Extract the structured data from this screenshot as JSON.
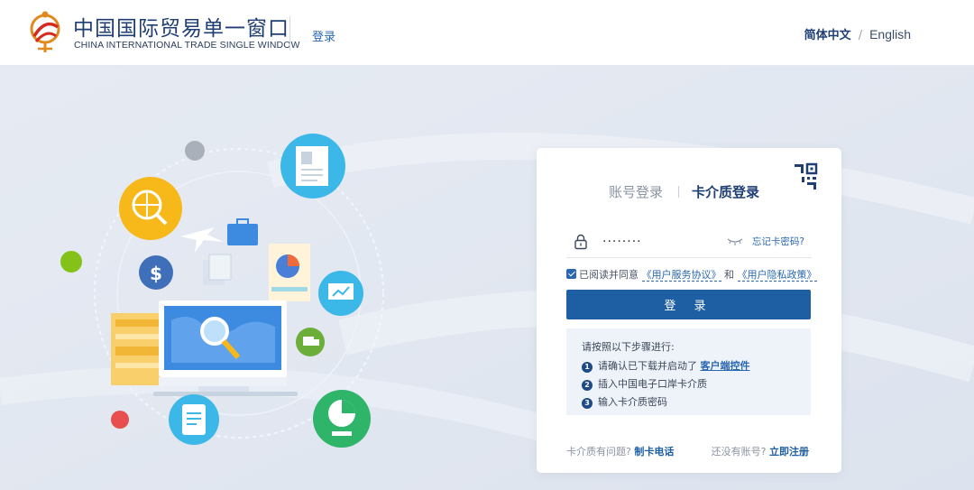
{
  "header": {
    "logo_title": "中国国际贸易单一窗口",
    "logo_subtitle": "CHINA INTERNATIONAL TRADE SINGLE WINDOW",
    "login_link": "登录",
    "lang_zh": "简体中文",
    "lang_sep": "/",
    "lang_en": "English"
  },
  "login": {
    "tab_account": "账号登录",
    "tab_card": "卡介质登录",
    "password_value": "········",
    "forgot_label": "忘记卡密码?",
    "agree_prefix": "已阅读并同意",
    "agree_terms": "《用户服务协议》",
    "agree_and": "和",
    "agree_privacy": "《用户隐私政策》",
    "agreed": true,
    "submit_label": "登 录",
    "steps_title": "请按照以下步骤进行:",
    "steps": [
      {
        "num": "1",
        "text": "请确认已下载并启动了",
        "link": "客户端控件"
      },
      {
        "num": "2",
        "text": "插入中国电子口岸卡介质",
        "link": ""
      },
      {
        "num": "3",
        "text": "输入卡介质密码",
        "link": ""
      }
    ],
    "help_prefix": "卡介质有问题?",
    "help_link": "制卡电话",
    "register_prefix": "还没有账号?",
    "register_link": "立即注册"
  },
  "colors": {
    "brand_blue": "#1e5fa4",
    "link_blue": "#2a67b0",
    "title_navy": "#1f3e73",
    "page_bg": "#e3e8f1"
  }
}
